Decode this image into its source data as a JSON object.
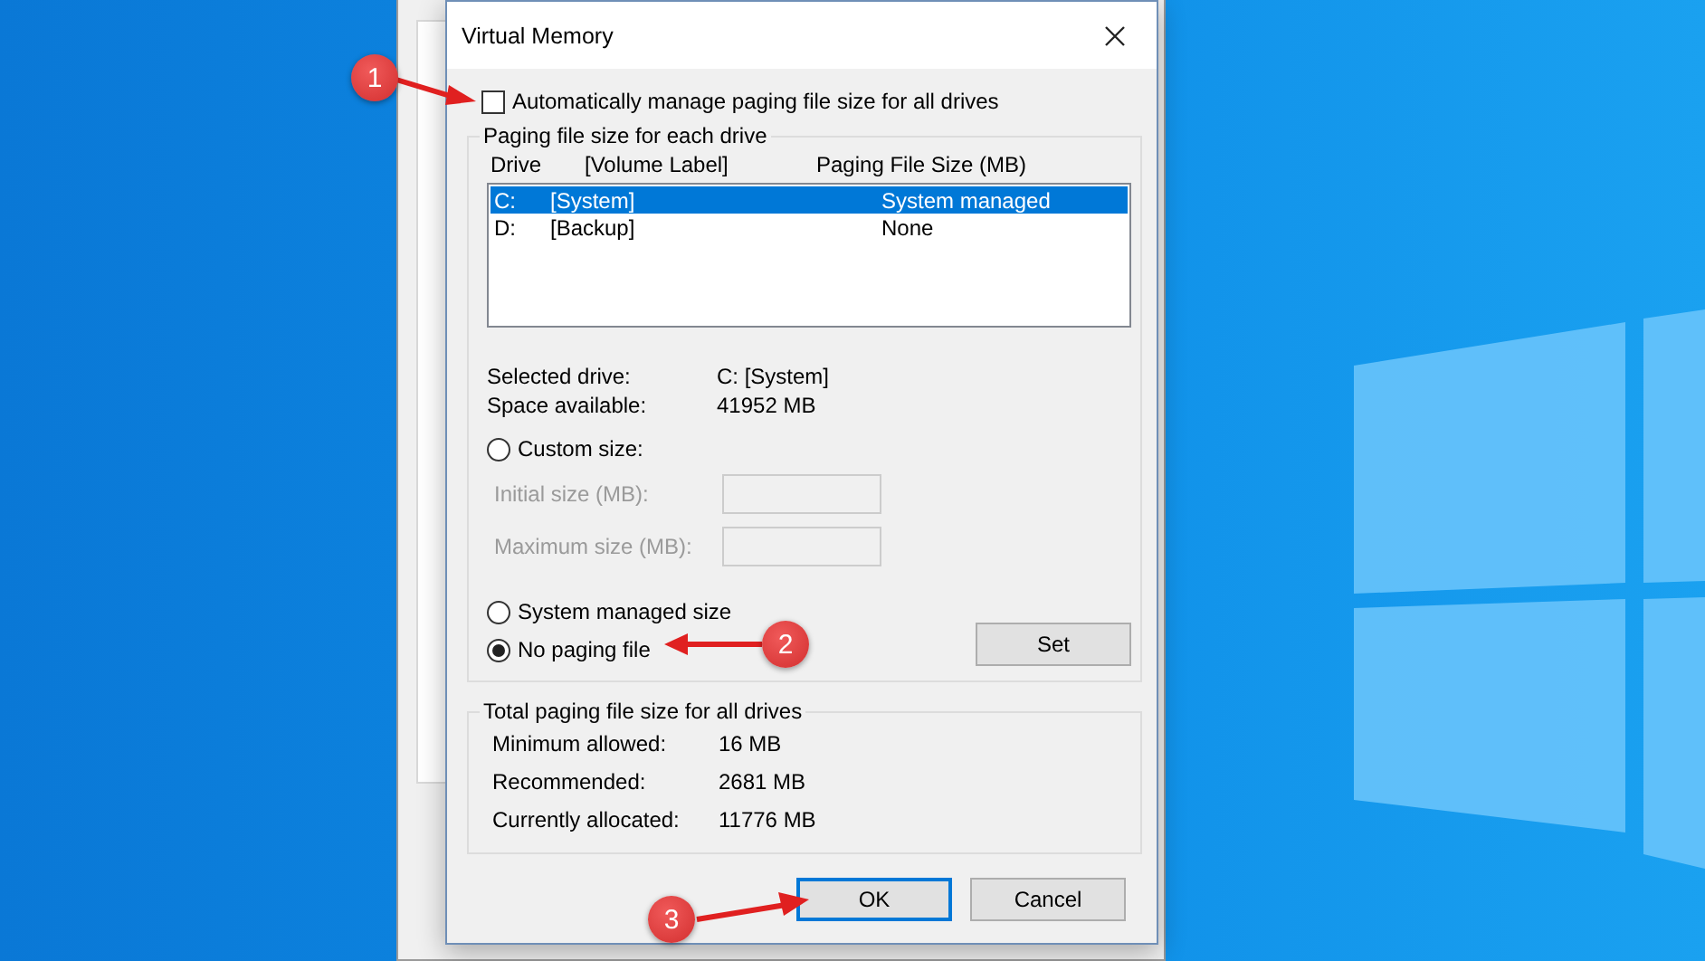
{
  "dialog": {
    "title": "Virtual Memory",
    "auto_manage": {
      "label": "Automatically manage paging file size for all drives",
      "checked": false
    },
    "drive_group": {
      "title": "Paging file size for each drive",
      "columns": [
        "Drive",
        "[Volume Label]",
        "Paging File Size (MB)"
      ],
      "rows": [
        {
          "drive": "C:",
          "label": "[System]",
          "size": "System managed",
          "selected": true
        },
        {
          "drive": "D:",
          "label": "[Backup]",
          "size": "None",
          "selected": false
        }
      ],
      "info": [
        {
          "label": "Selected drive:",
          "value": "C:  [System]"
        },
        {
          "label": "Space available:",
          "value": "41952 MB"
        }
      ],
      "custom": {
        "label": "Custom size:",
        "selected": false
      },
      "fields": [
        {
          "label": "Initial size (MB):",
          "disabled": true
        },
        {
          "label": "Maximum size (MB):",
          "disabled": true
        }
      ],
      "options": [
        {
          "label": "System managed size",
          "selected": false
        },
        {
          "label": "No paging file",
          "selected": true
        }
      ],
      "set_button": "Set"
    },
    "totals_group": {
      "title": "Total paging file size for all drives",
      "rows": [
        {
          "label": "Minimum allowed:",
          "value": "16 MB"
        },
        {
          "label": "Recommended:",
          "value": "2681 MB"
        },
        {
          "label": "Currently allocated:",
          "value": "11776 MB"
        }
      ]
    },
    "buttons": [
      {
        "label": "OK",
        "default": true
      },
      {
        "label": "Cancel",
        "default": false
      }
    ]
  },
  "callouts": [
    {
      "number": "1"
    },
    {
      "number": "2"
    },
    {
      "number": "3"
    }
  ]
}
